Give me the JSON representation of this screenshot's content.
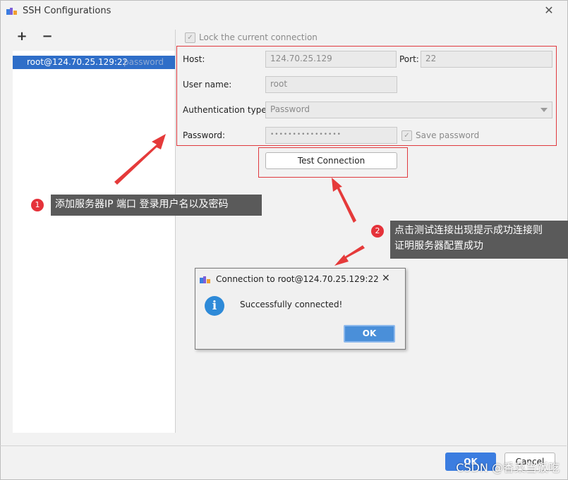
{
  "window": {
    "title": "SSH Configurations",
    "close_symbol": "✕"
  },
  "toolbar": {
    "add_symbol": "+",
    "remove_symbol": "−"
  },
  "list": {
    "items": [
      {
        "host": "root@124.70.25.129:22",
        "auth": "password"
      }
    ]
  },
  "form": {
    "lock_label": "Lock the current connection",
    "host_label": "Host:",
    "host_value": "124.70.25.129",
    "port_label": "Port:",
    "port_value": "22",
    "username_label": "User name:",
    "username_value": "root",
    "auth_label": "Authentication type:",
    "auth_value": "Password",
    "password_label": "Password:",
    "password_value": "••••••••••••••••",
    "save_password_label": "Save password",
    "test_button": "Test Connection"
  },
  "annotations": {
    "callout1_num": "1",
    "callout1_text": "添加服务器IP 端口 登录用户名以及密码",
    "callout2_num": "2",
    "callout2_line1": "点击测试连接出现提示成功连接则",
    "callout2_line2": "证明服务器配置成功"
  },
  "popup": {
    "title": "Connection to root@124.70.25.129:22",
    "close_symbol": "✕",
    "message": "Successfully connected!",
    "ok_label": "OK",
    "info_symbol": "i"
  },
  "footer": {
    "ok_label": "OK",
    "cancel_label": "Cancel"
  },
  "watermark": "CSDN @香菜当饭吃",
  "colors": {
    "accent": "#2f6ec8",
    "annotation_red": "#e0393e",
    "callout_bg": "#5a5a5a",
    "info_blue": "#2e8ad8"
  }
}
